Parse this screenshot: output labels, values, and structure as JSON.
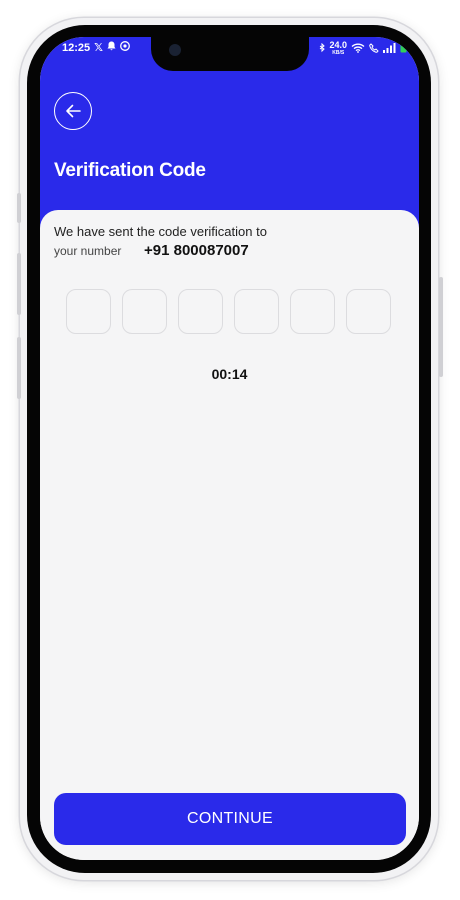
{
  "status_bar": {
    "time": "12:25",
    "left_icons": [
      "x-icon",
      "bell-icon",
      "whatsapp-icon"
    ],
    "speed_value": "24.0",
    "speed_unit": "KB/S"
  },
  "header": {
    "title": "Verification Code",
    "back_icon": "arrow-left-icon"
  },
  "message": {
    "line1": "We have sent the code verification to",
    "line2": "your number",
    "phone_number": "+91 800087007"
  },
  "otp": {
    "digits": [
      "",
      "",
      "",
      "",
      "",
      ""
    ]
  },
  "timer": "00:14",
  "continue_label": "CONTINUE",
  "colors": {
    "primary": "#2a2aea",
    "background": "#f5f5f6",
    "text": "#111111"
  }
}
